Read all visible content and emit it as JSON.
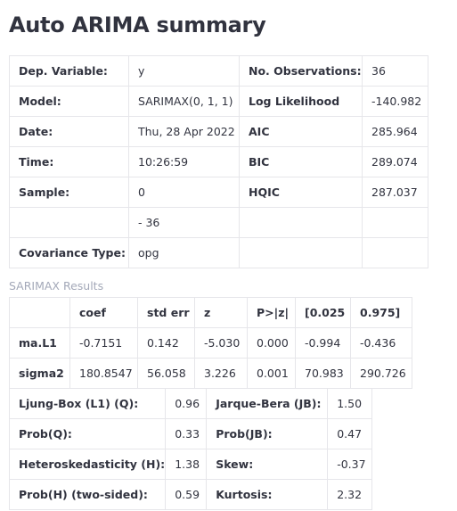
{
  "title": "Auto ARIMA summary",
  "summary_table": {
    "rows": [
      [
        "Dep. Variable:",
        "y",
        "No. Observations:",
        "36"
      ],
      [
        "Model:",
        "SARIMAX(0, 1, 1)",
        "Log Likelihood",
        "-140.982"
      ],
      [
        "Date:",
        "Thu, 28 Apr 2022",
        "AIC",
        "285.964"
      ],
      [
        "Time:",
        "10:26:59",
        "BIC",
        "289.074"
      ],
      [
        "Sample:",
        "0",
        "HQIC",
        "287.037"
      ],
      [
        "",
        "- 36",
        "",
        ""
      ],
      [
        "Covariance Type:",
        "opg",
        "",
        ""
      ]
    ]
  },
  "results_caption": "SARIMAX Results",
  "coef_table": {
    "headers": [
      "",
      "coef",
      "std err",
      "z",
      "P>|z|",
      "[0.025",
      "0.975]"
    ],
    "rows": [
      [
        "ma.L1",
        "-0.7151",
        "0.142",
        "-5.030",
        "0.000",
        "-0.994",
        "-0.436"
      ],
      [
        "sigma2",
        "180.8547",
        "56.058",
        "3.226",
        "0.001",
        "70.983",
        "290.726"
      ]
    ]
  },
  "diag_table": {
    "rows": [
      [
        "Ljung-Box (L1) (Q):",
        "0.96",
        "Jarque-Bera (JB):",
        "1.50"
      ],
      [
        "Prob(Q):",
        "0.33",
        "Prob(JB):",
        "0.47"
      ],
      [
        "Heteroskedasticity (H):",
        "1.38",
        "Skew:",
        "-0.37"
      ],
      [
        "Prob(H) (two-sided):",
        "0.59",
        "Kurtosis:",
        "2.32"
      ]
    ]
  }
}
